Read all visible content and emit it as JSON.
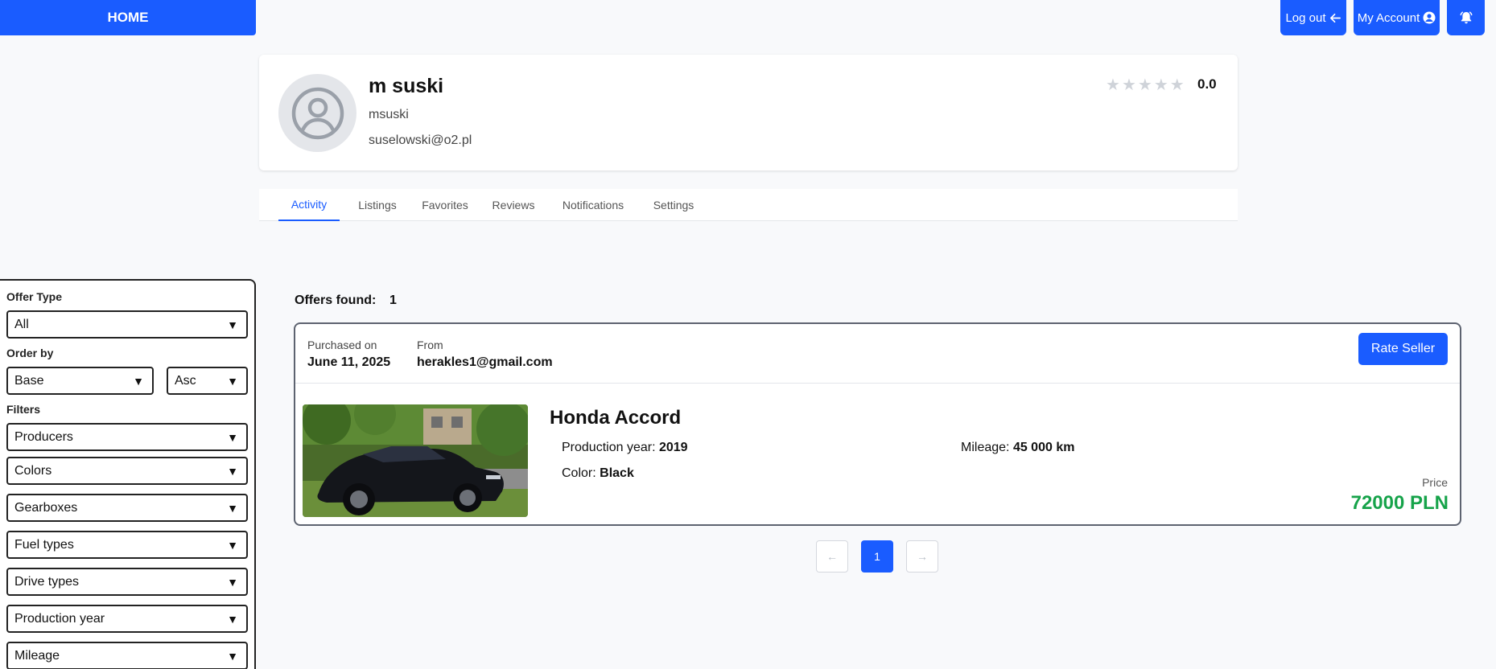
{
  "header": {
    "home_label": "HOME",
    "logout_label": "Log out",
    "account_label": "My Account"
  },
  "profile": {
    "name": "m suski",
    "username": "msuski",
    "email": "suselowski@o2.pl",
    "rating": "0.0",
    "stars_filled": 0,
    "stars_total": 5
  },
  "tabs": [
    {
      "label": "Activity",
      "active": true
    },
    {
      "label": "Listings",
      "active": false
    },
    {
      "label": "Favorites",
      "active": false
    },
    {
      "label": "Reviews",
      "active": false
    },
    {
      "label": "Notifications",
      "active": false
    },
    {
      "label": "Settings",
      "active": false
    }
  ],
  "sidebar": {
    "offer_type_label": "Offer Type",
    "offer_type_value": "All",
    "order_by_label": "Order by",
    "order_by_value": "Base",
    "order_dir_value": "Asc",
    "filters_label": "Filters",
    "filters": [
      "Producers",
      "Colors",
      "Gearboxes",
      "Fuel types",
      "Drive types",
      "Production year",
      "Mileage"
    ]
  },
  "results": {
    "offers_found_label": "Offers found:",
    "offers_found_count": "1"
  },
  "offer": {
    "purchased_label": "Purchased on",
    "purchased_date": "June 11, 2025",
    "from_label": "From",
    "from_email": "herakles1@gmail.com",
    "rate_button": "Rate Seller",
    "title": "Honda Accord",
    "production_year_label": "Production year:",
    "production_year": "2019",
    "mileage_label": "Mileage:",
    "mileage": "45 000 km",
    "color_label": "Color:",
    "color": "Black",
    "price_label": "Price",
    "price": "72000 PLN"
  },
  "pagination": {
    "prev": "←",
    "current": "1",
    "next": "→"
  },
  "colors": {
    "accent": "#1a5cff",
    "price": "#16a34a"
  }
}
